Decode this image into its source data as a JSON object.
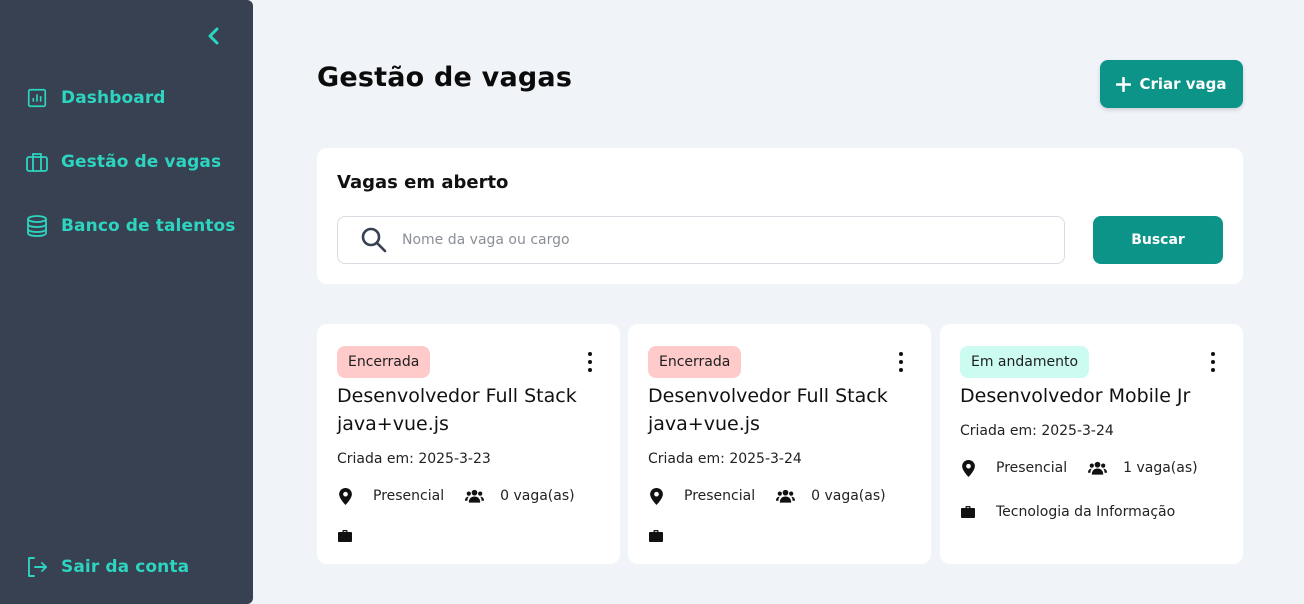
{
  "sidebar": {
    "items": [
      {
        "label": "Dashboard",
        "icon": "chart-icon"
      },
      {
        "label": "Gestão de vagas",
        "icon": "briefcase-icon"
      },
      {
        "label": "Banco de talentos",
        "icon": "database-icon"
      }
    ],
    "logout_label": "Sair da conta",
    "accent_color": "#2dd4bf",
    "background_color": "#374151"
  },
  "header": {
    "title": "Gestão de vagas",
    "create_label": "Criar vaga"
  },
  "search": {
    "title": "Vagas em aberto",
    "placeholder": "Nome da vaga ou cargo",
    "value": "",
    "button_label": "Buscar"
  },
  "jobs": [
    {
      "status": "Encerrada",
      "status_color": "#fecaca",
      "title": "Desenvolvedor Full Stack java+vue.js",
      "created": "Criada em: 2025-3-23",
      "mode": "Presencial",
      "openings": "0 vaga(as)",
      "department": ""
    },
    {
      "status": "Encerrada",
      "status_color": "#fecaca",
      "title": "Desenvolvedor Full Stack java+vue.js",
      "created": "Criada em: 2025-3-24",
      "mode": "Presencial",
      "openings": "0 vaga(as)",
      "department": ""
    },
    {
      "status": "Em andamento",
      "status_color": "#ccfbf1",
      "title": "Desenvolvedor Mobile Jr",
      "created": "Criada em: 2025-3-24",
      "mode": "Presencial",
      "openings": "1 vaga(as)",
      "department": "Tecnologia da Informação"
    }
  ],
  "brand_color": "#0d9488"
}
